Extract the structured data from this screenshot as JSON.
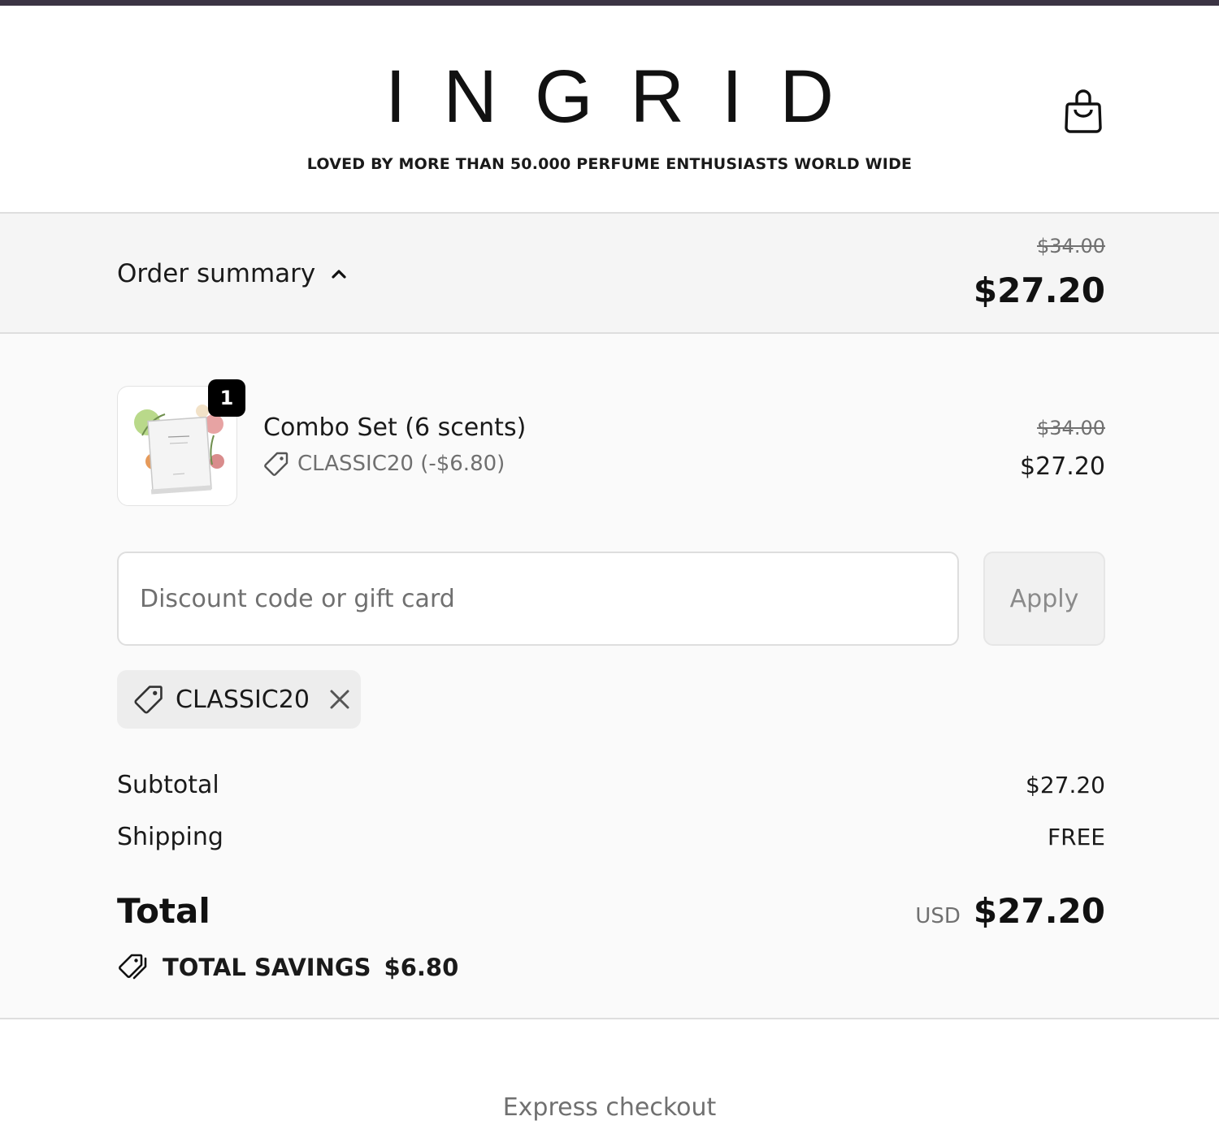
{
  "header": {
    "logo_text": "INGRID",
    "tagline": "LOVED BY MORE THAN 50.000 PERFUME ENTHUSIASTS WORLD WIDE",
    "cart_icon": "shopping-bag-icon"
  },
  "summary_bar": {
    "label": "Order summary",
    "toggle_icon": "chevron-up-icon",
    "original_total": "$34.00",
    "total": "$27.20"
  },
  "line_item": {
    "quantity": "1",
    "title": "Combo Set (6 scents)",
    "discount_icon": "tag-icon",
    "discount": "CLASSIC20 (-$6.80)",
    "original_price": "$34.00",
    "price": "$27.20"
  },
  "discount_form": {
    "placeholder": "Discount code or gift card",
    "value": "",
    "apply_label": "Apply"
  },
  "applied_code": {
    "icon": "tag-icon",
    "code": "CLASSIC20",
    "remove_icon": "close-icon"
  },
  "totals": {
    "subtotal_label": "Subtotal",
    "subtotal_value": "$27.20",
    "shipping_label": "Shipping",
    "shipping_value": "FREE",
    "total_label": "Total",
    "currency": "USD",
    "total_value": "$27.20",
    "savings_icon": "tags-icon",
    "savings_label": "TOTAL SAVINGS",
    "savings_value": "$6.80"
  },
  "express_checkout_label": "Express checkout",
  "colors": {
    "top_strip": "#3b3444",
    "summary_bg": "#f5f5f5",
    "panel_bg": "#fafafa",
    "badge_bg": "#000000",
    "muted_text": "#707070"
  }
}
